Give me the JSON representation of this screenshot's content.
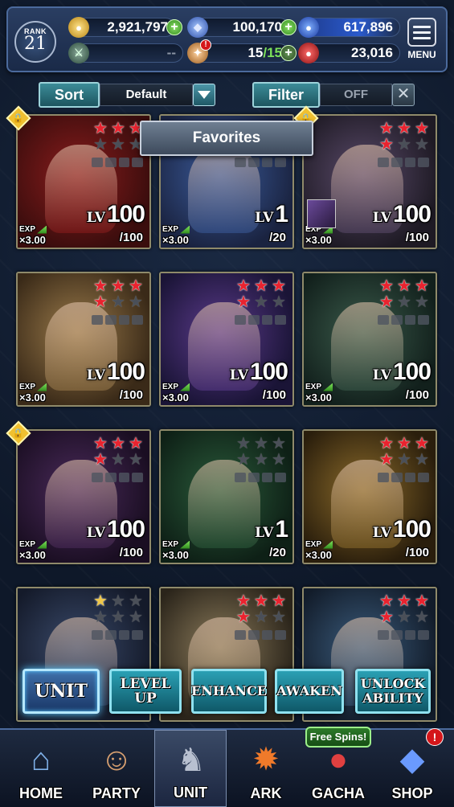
{
  "header": {
    "rank_label": "RANK",
    "rank_value": "21",
    "gold": "2,921,797",
    "crystals": "100,170",
    "energy_orbs": "617,896",
    "arena_value": "--",
    "stamina": "15",
    "stamina_max": "/15",
    "honor": "23,016",
    "menu_label": "MENU"
  },
  "sort": {
    "label": "Sort",
    "value": "Default"
  },
  "filter": {
    "label": "Filter",
    "value": "OFF"
  },
  "tooltip": "Favorites",
  "units": [
    {
      "lv_tag": "LV",
      "lv": "100",
      "max": "/100",
      "exp_tag": "EXP",
      "exp": "×3.00",
      "stars": [
        1,
        1,
        1,
        0,
        0,
        0
      ],
      "locked": true,
      "theme": "#8a1c1c,#3a0d0d"
    },
    {
      "lv_tag": "LV",
      "lv": "1",
      "max": "/20",
      "exp_tag": "EXP",
      "exp": "×3.00",
      "stars": [
        0,
        0,
        0,
        0,
        0,
        0
      ],
      "locked": false,
      "theme": "#3a5a9a,#1a2340"
    },
    {
      "lv_tag": "LV",
      "lv": "100",
      "max": "/100",
      "exp_tag": "EXP",
      "exp": "×3.00",
      "stars": [
        1,
        1,
        1,
        1,
        0,
        0
      ],
      "locked": true,
      "theme": "#5a4a6a,#1e1a24"
    },
    {
      "lv_tag": "LV",
      "lv": "100",
      "max": "/100",
      "exp_tag": "EXP",
      "exp": "×3.00",
      "stars": [
        1,
        1,
        1,
        1,
        0,
        0
      ],
      "locked": false,
      "theme": "#9a7a4a,#3a2a18"
    },
    {
      "lv_tag": "LV",
      "lv": "100",
      "max": "/100",
      "exp_tag": "EXP",
      "exp": "×3.00",
      "stars": [
        1,
        1,
        1,
        1,
        0,
        0
      ],
      "locked": false,
      "theme": "#5a3a8a,#1a1436"
    },
    {
      "lv_tag": "LV",
      "lv": "100",
      "max": "/100",
      "exp_tag": "EXP",
      "exp": "×3.00",
      "stars": [
        1,
        1,
        1,
        1,
        0,
        0
      ],
      "locked": false,
      "theme": "#3a5a4a,#12201c"
    },
    {
      "lv_tag": "LV",
      "lv": "100",
      "max": "/100",
      "exp_tag": "EXP",
      "exp": "×3.00",
      "stars": [
        1,
        1,
        1,
        1,
        0,
        0
      ],
      "locked": true,
      "theme": "#4a2a5a,#1a0e22"
    },
    {
      "lv_tag": "LV",
      "lv": "1",
      "max": "/20",
      "exp_tag": "EXP",
      "exp": "×3.00",
      "stars": [
        0,
        0,
        0,
        0,
        0,
        0
      ],
      "locked": false,
      "theme": "#2a5a3a,#0e2016"
    },
    {
      "lv_tag": "LV",
      "lv": "100",
      "max": "/100",
      "exp_tag": "EXP",
      "exp": "×3.00",
      "stars": [
        1,
        1,
        1,
        1,
        0,
        0
      ],
      "locked": false,
      "theme": "#8a6a2a,#2a1e0c"
    },
    {
      "lv_tag": "",
      "lv": "",
      "max": "",
      "exp_tag": "",
      "exp": "",
      "stars": [
        2,
        0,
        0,
        0,
        0,
        0
      ],
      "locked": false,
      "theme": "#3a4a6a,#141a2a"
    },
    {
      "lv_tag": "",
      "lv": "",
      "max": "",
      "exp_tag": "",
      "exp": "",
      "stars": [
        1,
        1,
        1,
        1,
        0,
        0
      ],
      "locked": false,
      "theme": "#8a7a5a,#2a241a"
    },
    {
      "lv_tag": "",
      "lv": "",
      "max": "",
      "exp_tag": "",
      "exp": "",
      "stars": [
        1,
        1,
        1,
        1,
        0,
        0
      ],
      "locked": false,
      "theme": "#3a5a7a,#121c2a"
    }
  ],
  "actions": [
    {
      "label": "UNIT"
    },
    {
      "label": "LEVEL UP"
    },
    {
      "label": "ENHANCE"
    },
    {
      "label": "AWAKEN"
    },
    {
      "label": "UNLOCK ABILITY"
    }
  ],
  "nav": [
    {
      "label": "HOME",
      "icon": "home-icon"
    },
    {
      "label": "PARTY",
      "icon": "party-icon"
    },
    {
      "label": "UNIT",
      "icon": "unit-icon"
    },
    {
      "label": "ARK",
      "icon": "ark-icon"
    },
    {
      "label": "GACHA",
      "icon": "gacha-icon"
    },
    {
      "label": "SHOP",
      "icon": "shop-icon"
    }
  ],
  "free_spins": "Free Spins!",
  "colors": {
    "accent_teal": "#2aa0b4",
    "star_red": "#e9232f",
    "plus_green": "#2f8a1c"
  }
}
